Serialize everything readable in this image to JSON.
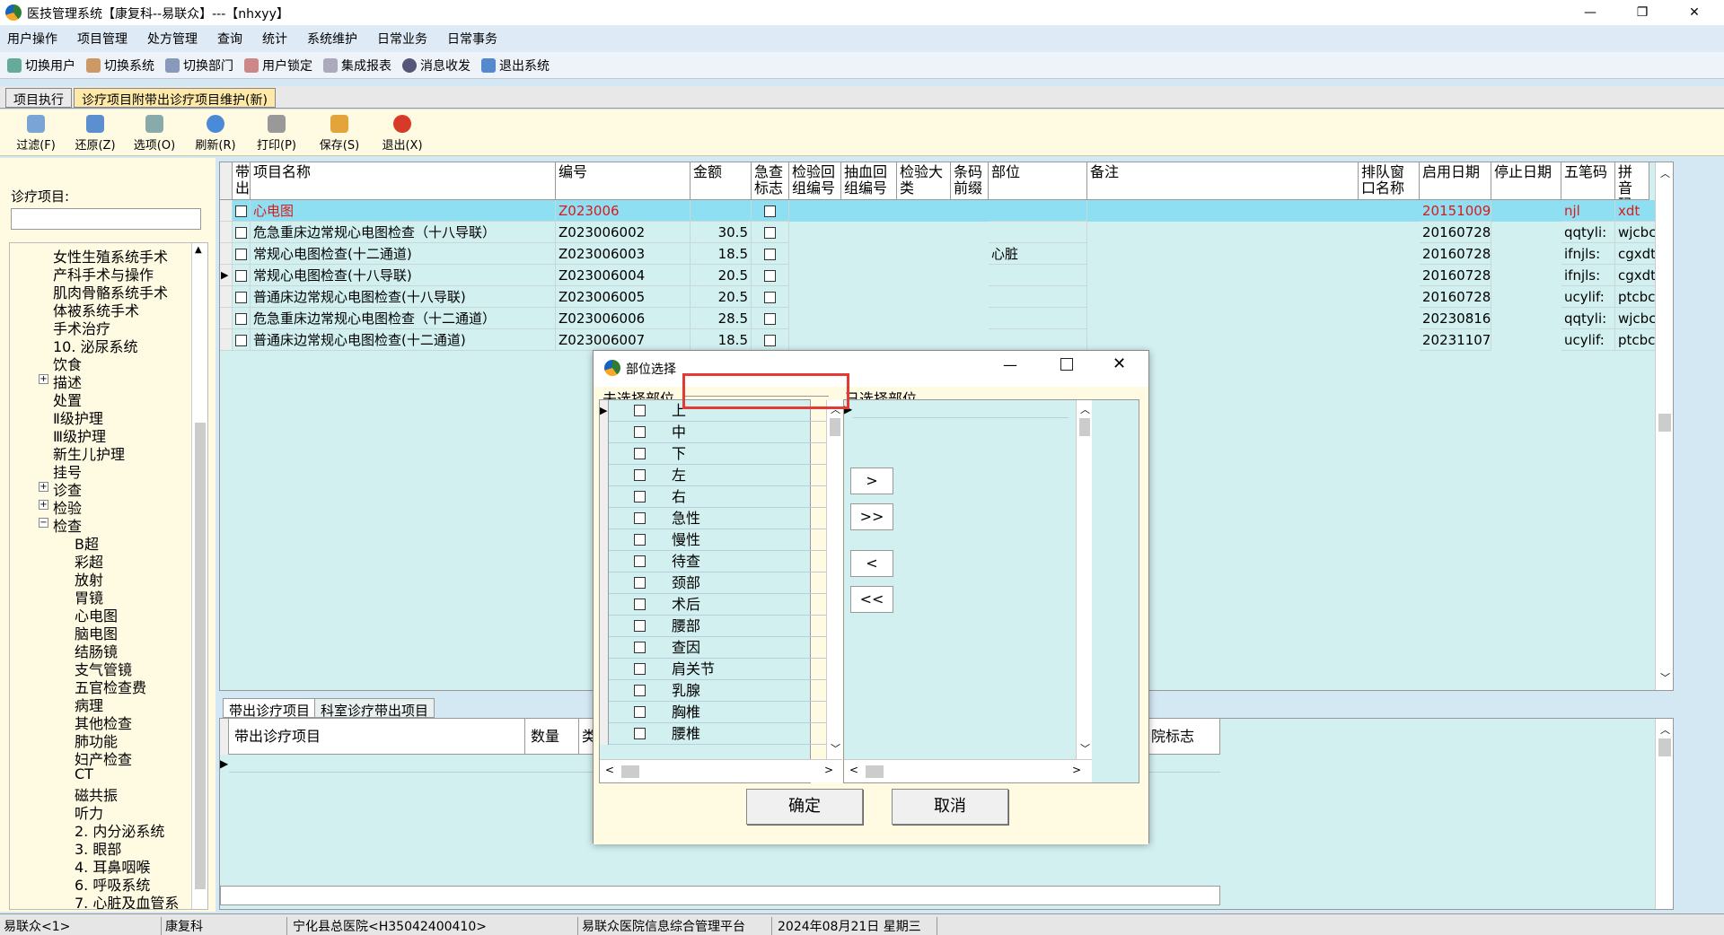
{
  "window": {
    "title": "医技管理系统【康复科--易联众】---【nhxyy】",
    "min": "—",
    "max": "❐",
    "close": "✕"
  },
  "menu": [
    "用户操作",
    "项目管理",
    "处方管理",
    "查询",
    "统计",
    "系统维护",
    "日常业务",
    "日常事务"
  ],
  "toolbar": [
    "切换用户",
    "切换系统",
    "切换部门",
    "用户锁定",
    "集成报表",
    "消息收发",
    "退出系统"
  ],
  "tabs": [
    "项目执行",
    "诊疗项目附带出诊疗项目维护(新)"
  ],
  "actions": [
    "过滤(F)",
    "还原(Z)",
    "选项(O)",
    "刷新(R)",
    "打印(P)",
    "保存(S)",
    "退出(X)"
  ],
  "left": {
    "label": "诊疗项目:"
  },
  "tree": [
    {
      "text": "女性生殖系统手术",
      "level": 1
    },
    {
      "text": "产科手术与操作",
      "level": 1
    },
    {
      "text": "肌肉骨骼系统手术",
      "level": 1
    },
    {
      "text": "体被系统手术",
      "level": 1
    },
    {
      "text": "手术治疗",
      "level": 1
    },
    {
      "text": "10. 泌尿系统",
      "level": 1
    },
    {
      "text": "饮食",
      "level": 1
    },
    {
      "text": "描述",
      "level": 1,
      "exp": "+"
    },
    {
      "text": "处置",
      "level": 1
    },
    {
      "text": "Ⅱ级护理",
      "level": 1
    },
    {
      "text": "Ⅲ级护理",
      "level": 1
    },
    {
      "text": "新生儿护理",
      "level": 1
    },
    {
      "text": "挂号",
      "level": 1
    },
    {
      "text": "诊查",
      "level": 1,
      "exp": "+"
    },
    {
      "text": "检验",
      "level": 1,
      "exp": "+"
    },
    {
      "text": "检查",
      "level": 1,
      "exp": "−"
    },
    {
      "text": "B超",
      "level": 2
    },
    {
      "text": "彩超",
      "level": 2
    },
    {
      "text": "放射",
      "level": 2
    },
    {
      "text": "胃镜",
      "level": 2
    },
    {
      "text": "心电图",
      "level": 2
    },
    {
      "text": "脑电图",
      "level": 2
    },
    {
      "text": "结肠镜",
      "level": 2
    },
    {
      "text": "支气管镜",
      "level": 2
    },
    {
      "text": "五官检查费",
      "level": 2
    },
    {
      "text": "病理",
      "level": 2
    },
    {
      "text": "其他检查",
      "level": 2
    },
    {
      "text": "肺功能",
      "level": 2
    },
    {
      "text": "妇产检查",
      "level": 2
    },
    {
      "text": "CT",
      "level": 2
    },
    {
      "text": "磁共振",
      "level": 2
    },
    {
      "text": "听力",
      "level": 2
    },
    {
      "text": "2. 内分泌系统",
      "level": 2
    },
    {
      "text": "3. 眼部",
      "level": 2
    },
    {
      "text": "4. 耳鼻咽喉",
      "level": 2
    },
    {
      "text": "6. 呼吸系统",
      "level": 2
    },
    {
      "text": "7. 心脏及血管系",
      "level": 2
    }
  ],
  "grid": {
    "headers": [
      "带出",
      "项目名称",
      "编号",
      "金额",
      "急查标志",
      "检验回组编号",
      "抽血回组编号",
      "检验大类",
      "条码前缀",
      "部位",
      "备注",
      "排队窗口名称",
      "启用日期",
      "停止日期",
      "五笔码",
      "拼音码"
    ],
    "rows": [
      {
        "name": "心电图",
        "code": "Z023006",
        "amount": "",
        "part": "",
        "start": "20151009",
        "wb": "njl",
        "py": "xdt",
        "selected": true
      },
      {
        "name": "危急重床边常规心电图检查（十八导联）",
        "code": "Z023006002",
        "amount": "30.5",
        "part": "",
        "start": "20160728",
        "wb": "qqtyli:",
        "py": "wjcbc"
      },
      {
        "name": "常规心电图检查(十二通道)",
        "code": "Z023006003",
        "amount": "18.5",
        "part": "心脏",
        "start": "20160728",
        "wb": "ifnjls:",
        "py": "cgxdtj"
      },
      {
        "name": "常规心电图检查(十八导联)",
        "code": "Z023006004",
        "amount": "20.5",
        "part": "",
        "start": "20160728",
        "wb": "ifnjls:",
        "py": "cgxdtj",
        "current": true
      },
      {
        "name": "普通床边常规心电图检查(十八导联)",
        "code": "Z023006005",
        "amount": "20.5",
        "part": "",
        "start": "20160728",
        "wb": "ucylif:",
        "py": "ptcbcg"
      },
      {
        "name": "危急重床边常规心电图检查（十二通道）",
        "code": "Z023006006",
        "amount": "28.5",
        "part": "",
        "start": "20230816",
        "wb": "qqtyli:",
        "py": "wjcbc"
      },
      {
        "name": "普通床边常规心电图检查(十二通道)",
        "code": "Z023006007",
        "amount": "18.5",
        "part": "",
        "start": "20231107",
        "wb": "ucylif:",
        "py": "ptcbcg"
      }
    ]
  },
  "bottom": {
    "tabs": [
      "带出诊疗项目",
      "科室诊疗带出项目"
    ],
    "headers": [
      "带出诊疗项目",
      "数量",
      "类",
      "院标志"
    ]
  },
  "dialog": {
    "title": "部位选择",
    "unselected_label": "未选择部位",
    "selected_label": "已选择部位",
    "parts": [
      "上",
      "中",
      "下",
      "左",
      "右",
      "急性",
      "慢性",
      "待查",
      "颈部",
      "术后",
      "腰部",
      "查因",
      "肩关节",
      "乳腺",
      "胸椎",
      "腰椎"
    ],
    "btn_add": ">",
    "btn_add_all": ">>",
    "btn_remove": "<",
    "btn_remove_all": "<<",
    "ok": "确定",
    "cancel": "取消"
  },
  "status": [
    "易联众<1>",
    "康复科",
    "宁化县总医院<H35042400410>",
    "易联众医院信息综合管理平台",
    "2024年08月21日 星期三"
  ]
}
